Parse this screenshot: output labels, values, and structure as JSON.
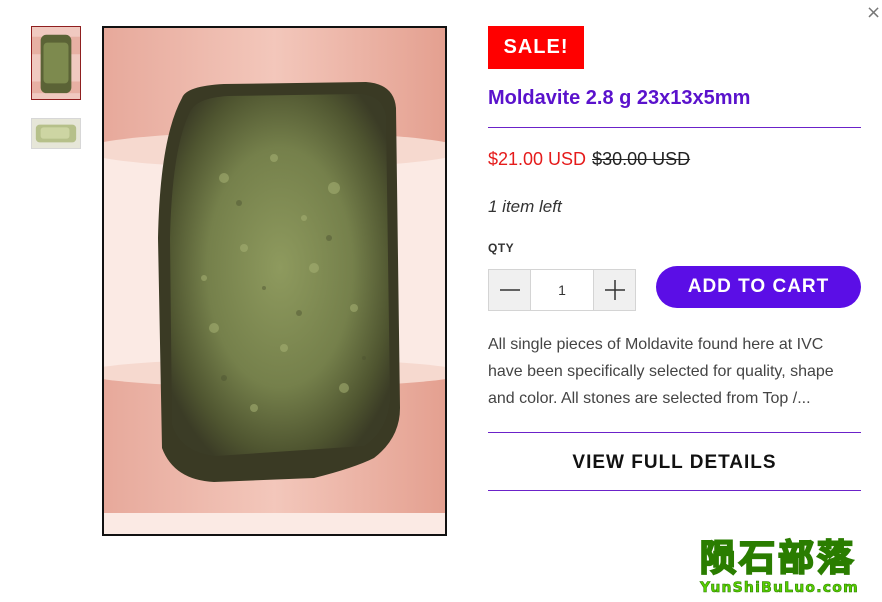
{
  "dialog": {
    "close_icon": "close-icon",
    "close_glyph": "×"
  },
  "gallery": {
    "thumbnails": [
      {
        "name": "thumbnail-front",
        "active": true
      },
      {
        "name": "thumbnail-side",
        "active": false
      }
    ],
    "main_image": "moldavite-held-between-fingers"
  },
  "product": {
    "badge": "SALE!",
    "title": "Moldavite 2.8 g 23x13x5mm",
    "sale_price": "$21.00 USD",
    "compare_price": "$30.00 USD",
    "stock": "1 item left",
    "qty_label": "QTY",
    "qty_value": "1",
    "add_to_cart": "ADD TO CART",
    "description": "All single pieces of Moldavite found here at IVC have been specifically selected for quality, shape and color. All stones are selected from Top /...",
    "view_details": "VIEW FULL DETAILS"
  },
  "watermark": {
    "text_cn": "陨石部落",
    "text_en": "YunShiBuLuo.com"
  },
  "colors": {
    "accent": "#5b0ee6",
    "title": "#5a12cc",
    "sale_badge": "#ff0000",
    "sale_price": "#e51b1b",
    "watermark": "#58d000"
  }
}
